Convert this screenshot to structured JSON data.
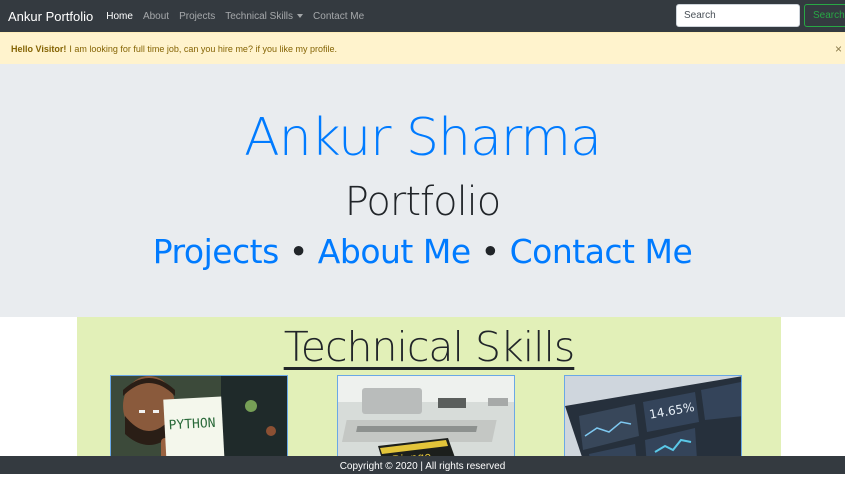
{
  "navbar": {
    "brand": "Ankur Portfolio",
    "links": [
      "Home",
      "About",
      "Projects",
      "Technical Skills",
      "Contact Me"
    ],
    "active": "Home",
    "search_placeholder": "Search",
    "search_button": "Search"
  },
  "alert": {
    "strong": "Hello Visitor!",
    "message": "I am looking for full time job, can you hire me? if you like my profile.",
    "close": "×"
  },
  "hero": {
    "name": "Ankur Sharma",
    "subtitle": "Portfolio",
    "link_projects": "Projects",
    "link_about": "About Me",
    "link_contact": "Contact Me",
    "separator": "•"
  },
  "skills": {
    "title": "Technical Skills",
    "cards": [
      {
        "text": "PYTHON"
      },
      {
        "text": "Django"
      },
      {
        "text": "14.65%"
      }
    ]
  },
  "footer": {
    "text": "Copyright © 2020 | All rights reserved"
  }
}
